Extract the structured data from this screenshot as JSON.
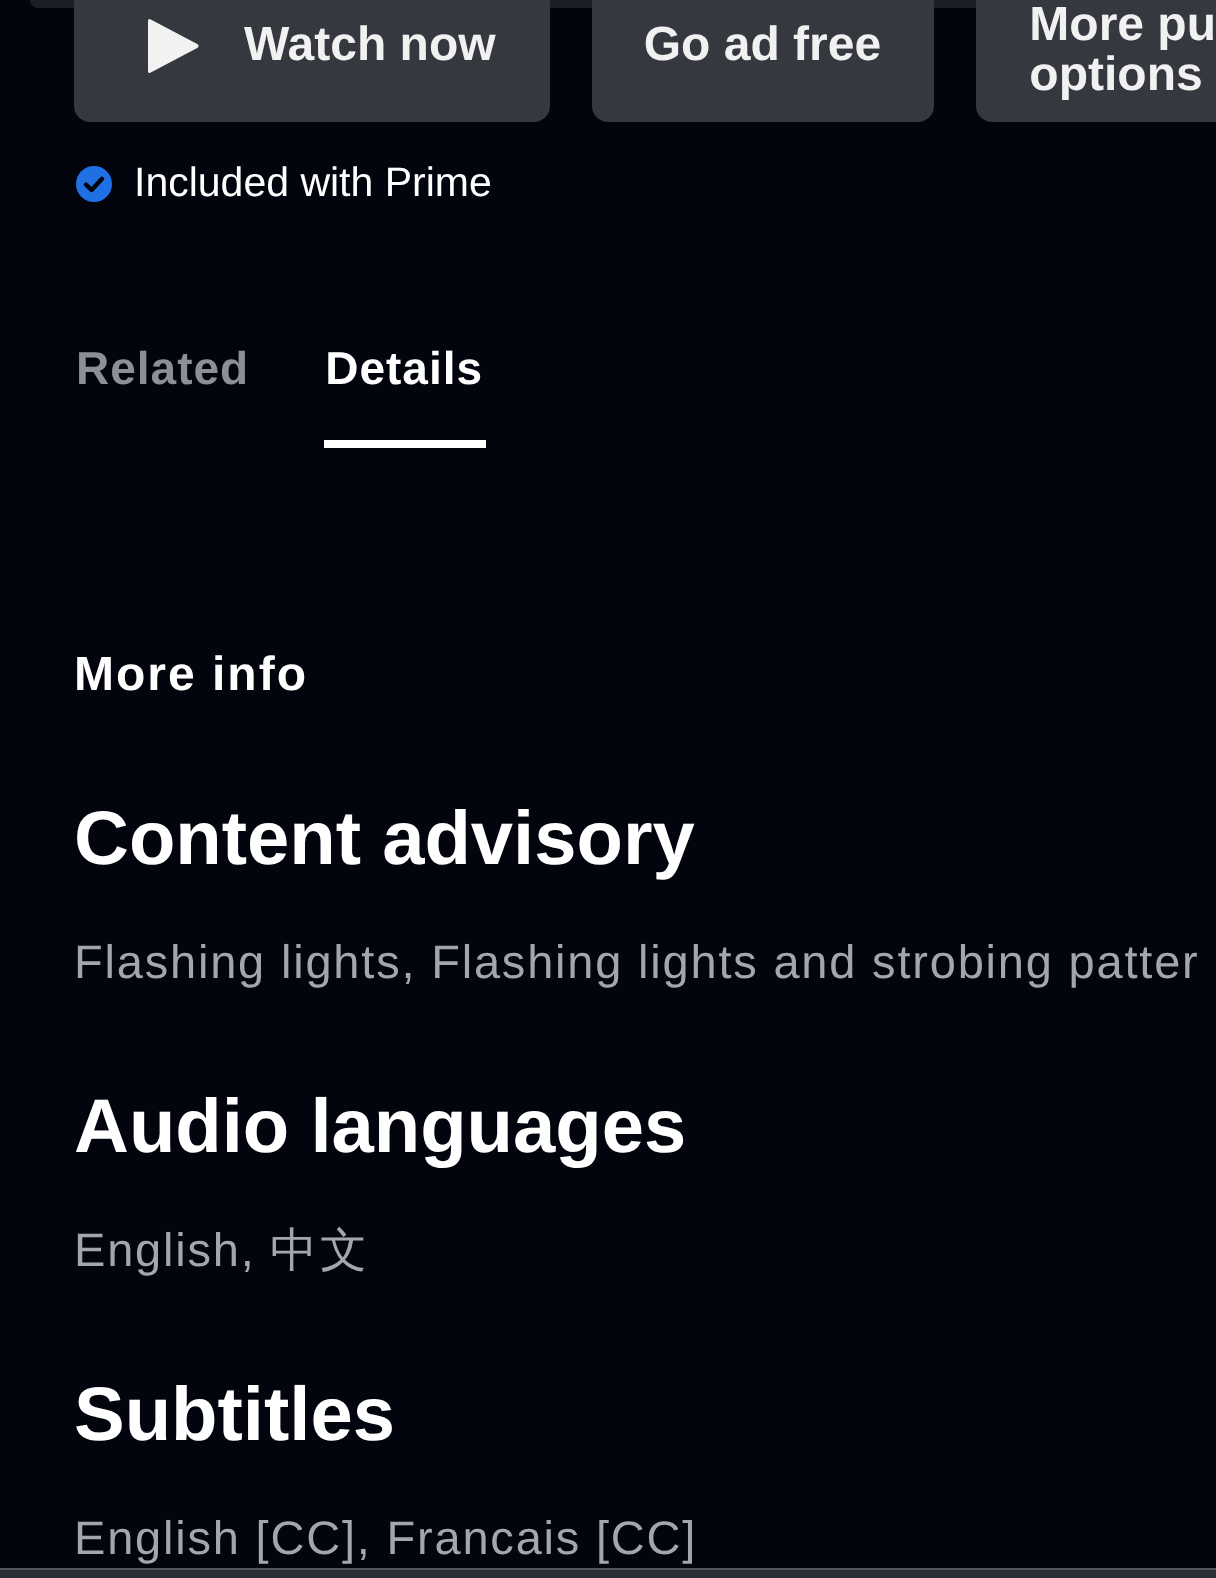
{
  "action_buttons": [
    {
      "kind": "icon_label",
      "label_lines": [
        "Watch now"
      ]
    },
    {
      "kind": "label",
      "label_lines": [
        "Go ad free"
      ]
    },
    {
      "kind": "label",
      "label_lines": [
        "More pu",
        "options"
      ]
    }
  ],
  "prime_status": {
    "label": "Included with Prime"
  },
  "tabs": [
    {
      "label": "Related",
      "selected": false
    },
    {
      "label": "Details",
      "selected": true
    }
  ],
  "details": {
    "title": "More info",
    "sections": [
      {
        "heading": "Content advisory",
        "text": "Flashing lights, Flashing lights and strobing patter"
      },
      {
        "heading": "Audio languages",
        "text": "English, 中文"
      },
      {
        "heading": "Subtitles",
        "text": "English [CC], Francais [CC]"
      }
    ]
  }
}
